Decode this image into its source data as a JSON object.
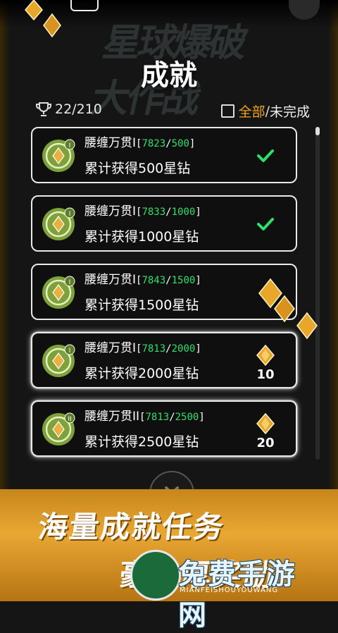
{
  "header": {
    "title": "成就",
    "logo_text": "星球爆破大作战",
    "trophy_count": "22/210"
  },
  "filter": {
    "all_label": "全部",
    "separator": "/",
    "incomplete_label": "未完成"
  },
  "cards": [
    {
      "name": "腰缠万贯",
      "level": "I",
      "current": "7823",
      "target": "500",
      "desc": "累计获得500星钻",
      "status": "done"
    },
    {
      "name": "腰缠万贯",
      "level": "I",
      "current": "7833",
      "target": "1000",
      "desc": "累计获得1000星钻",
      "status": "done"
    },
    {
      "name": "腰缠万贯",
      "level": "I",
      "current": "7843",
      "target": "1500",
      "desc": "累计获得1500星钻",
      "status": "claimable"
    },
    {
      "name": "腰缠万贯",
      "level": "I",
      "current": "7813",
      "target": "2000",
      "desc": "累计获得2000星钻",
      "status": "reward",
      "reward": "10"
    },
    {
      "name": "腰缠万贯",
      "level": "II",
      "current": "7813",
      "target": "2500",
      "desc": "累计获得2500星钻",
      "status": "reward",
      "reward": "20"
    }
  ],
  "banner": {
    "line1": "海量成就任务",
    "line2": "豪丰厚奖励"
  },
  "watermark": {
    "text": "免费手游网",
    "sub": "MIANFEISHOUYOUWANG"
  },
  "colors": {
    "accent": "#f2a51c",
    "progress": "#2ee06b",
    "gem": "#e8a62a"
  }
}
